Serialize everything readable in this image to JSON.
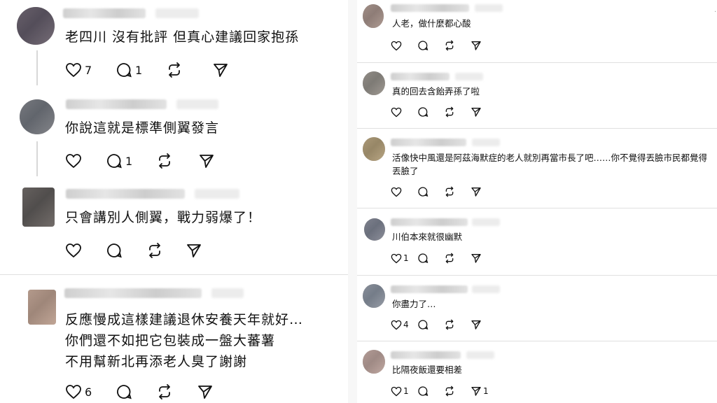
{
  "left_panel": {
    "comments": [
      {
        "text": "老四川 沒有批評 但真心建議回家抱孫",
        "likes": "7",
        "replies": "1",
        "tone": "#3f3b52"
      },
      {
        "text": "你說這就是標準側翼發言",
        "likes": "",
        "replies": "1",
        "tone": "#5a6674"
      },
      {
        "text": "只會講別人側翼，戰力弱爆了！",
        "likes": "",
        "replies": "",
        "tone": "#3a3a3a"
      },
      {
        "text": "反應慢成這樣建議退休安養天年就好…\n你們還不如把它包裝成一盤大蕃薯\n不用幫新北再添老人臭了謝謝",
        "likes": "6",
        "replies": "",
        "tone": "#c9a38c"
      }
    ]
  },
  "right_panel": {
    "comments": [
      {
        "text": "人老，做什麼都心酸",
        "likes": "",
        "reposts": "",
        "tone": "#a98f86"
      },
      {
        "text": "真的回去含飴弄孫了啦",
        "likes": "",
        "reposts": "",
        "tone": "#8d8d85"
      },
      {
        "text": "活像快中風還是阿茲海默症的老人就別再當市長了吧……你不覺得丟臉市民都覺得\n丟臉了",
        "likes": "",
        "reposts": "",
        "tone": "#b9a36a"
      },
      {
        "text": "川伯本來就很幽默",
        "likes": "1",
        "reposts": "",
        "tone": "#6a7891"
      },
      {
        "text": "你盡力了…",
        "likes": "4",
        "reposts": "",
        "tone": "#7b8fa8"
      },
      {
        "text": "比隔夜飯還要相差",
        "likes": "1",
        "reposts": "1",
        "tone": "#c9a8a0"
      }
    ]
  },
  "icons": {
    "like": "heart-icon",
    "reply": "comment-bubble-icon",
    "repost": "repost-icon",
    "share": "send-icon"
  }
}
